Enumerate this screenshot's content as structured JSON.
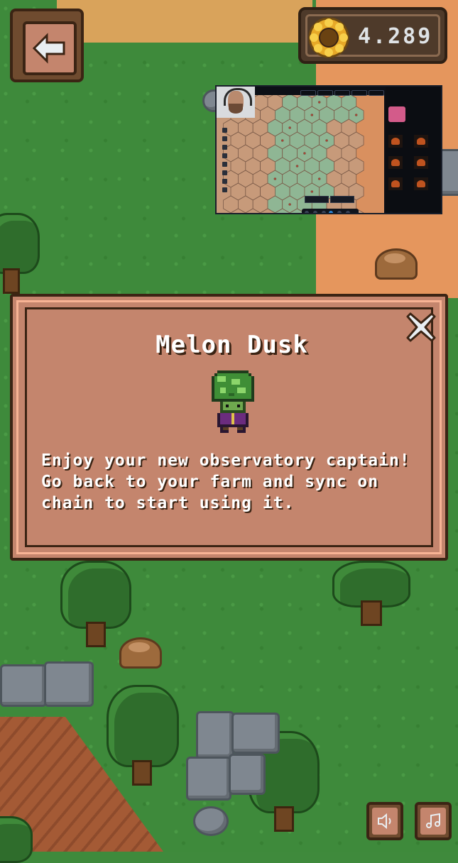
{
  "hud": {
    "balance": "4.289"
  },
  "modal": {
    "title": "Melon Dusk",
    "message": "Enjoy your new observatory captain! Go back to your farm and sync on chain to start using it."
  },
  "icons": {
    "back": "back-arrow-icon",
    "coin": "sunflower-coin-icon",
    "close": "close-icon",
    "sound": "speaker-icon",
    "music": "music-note-icon"
  },
  "colors": {
    "panel": "#c4856d",
    "panel_border": "#3b2414",
    "grass": "#3e8a3b",
    "text": "#ffffff"
  }
}
